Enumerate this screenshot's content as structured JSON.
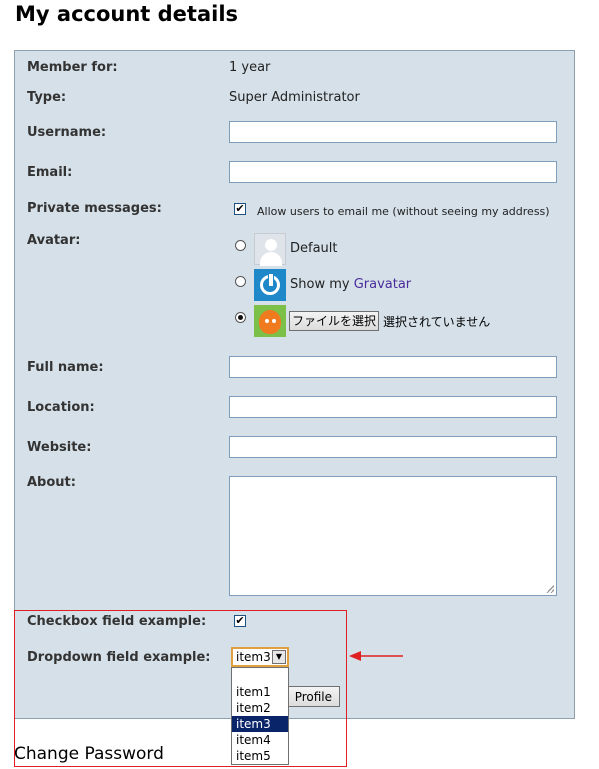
{
  "page": {
    "title": "My account details"
  },
  "account": {
    "member_for": {
      "label": "Member for:",
      "value": "1 year"
    },
    "type": {
      "label": "Type:",
      "value": "Super Administrator"
    },
    "username": {
      "label": "Username:",
      "value": ""
    },
    "email": {
      "label": "Email:",
      "value": ""
    },
    "private_messages": {
      "label": "Private messages:",
      "checked": true,
      "option_label": "Allow users to email me (without seeing my address)"
    },
    "avatar": {
      "label": "Avatar:",
      "options": [
        {
          "label": "Default",
          "selected": false
        },
        {
          "label_prefix": "Show my ",
          "link_text": "Gravatar",
          "selected": false
        },
        {
          "button_label": "ファイルを選択",
          "status_text": "選択されていません",
          "selected": true
        }
      ]
    },
    "full_name": {
      "label": "Full name:",
      "value": ""
    },
    "location": {
      "label": "Location:",
      "value": ""
    },
    "website": {
      "label": "Website:",
      "value": ""
    },
    "about": {
      "label": "About:",
      "value": ""
    },
    "checkbox_example": {
      "label": "Checkbox field example:",
      "checked": true
    },
    "dropdown_example": {
      "label": "Dropdown field example:",
      "selected_value": "item3",
      "options": [
        "item1",
        "item2",
        "item3",
        "item4",
        "item5"
      ],
      "highlighted_index": 2
    },
    "profile_button": "Profile"
  },
  "change_password": "Change Password",
  "colors": {
    "panel_bg": "#d5e0e8",
    "annotation_red": "#e02020",
    "link": "#4a2c9b",
    "selection": "#0a246a"
  }
}
